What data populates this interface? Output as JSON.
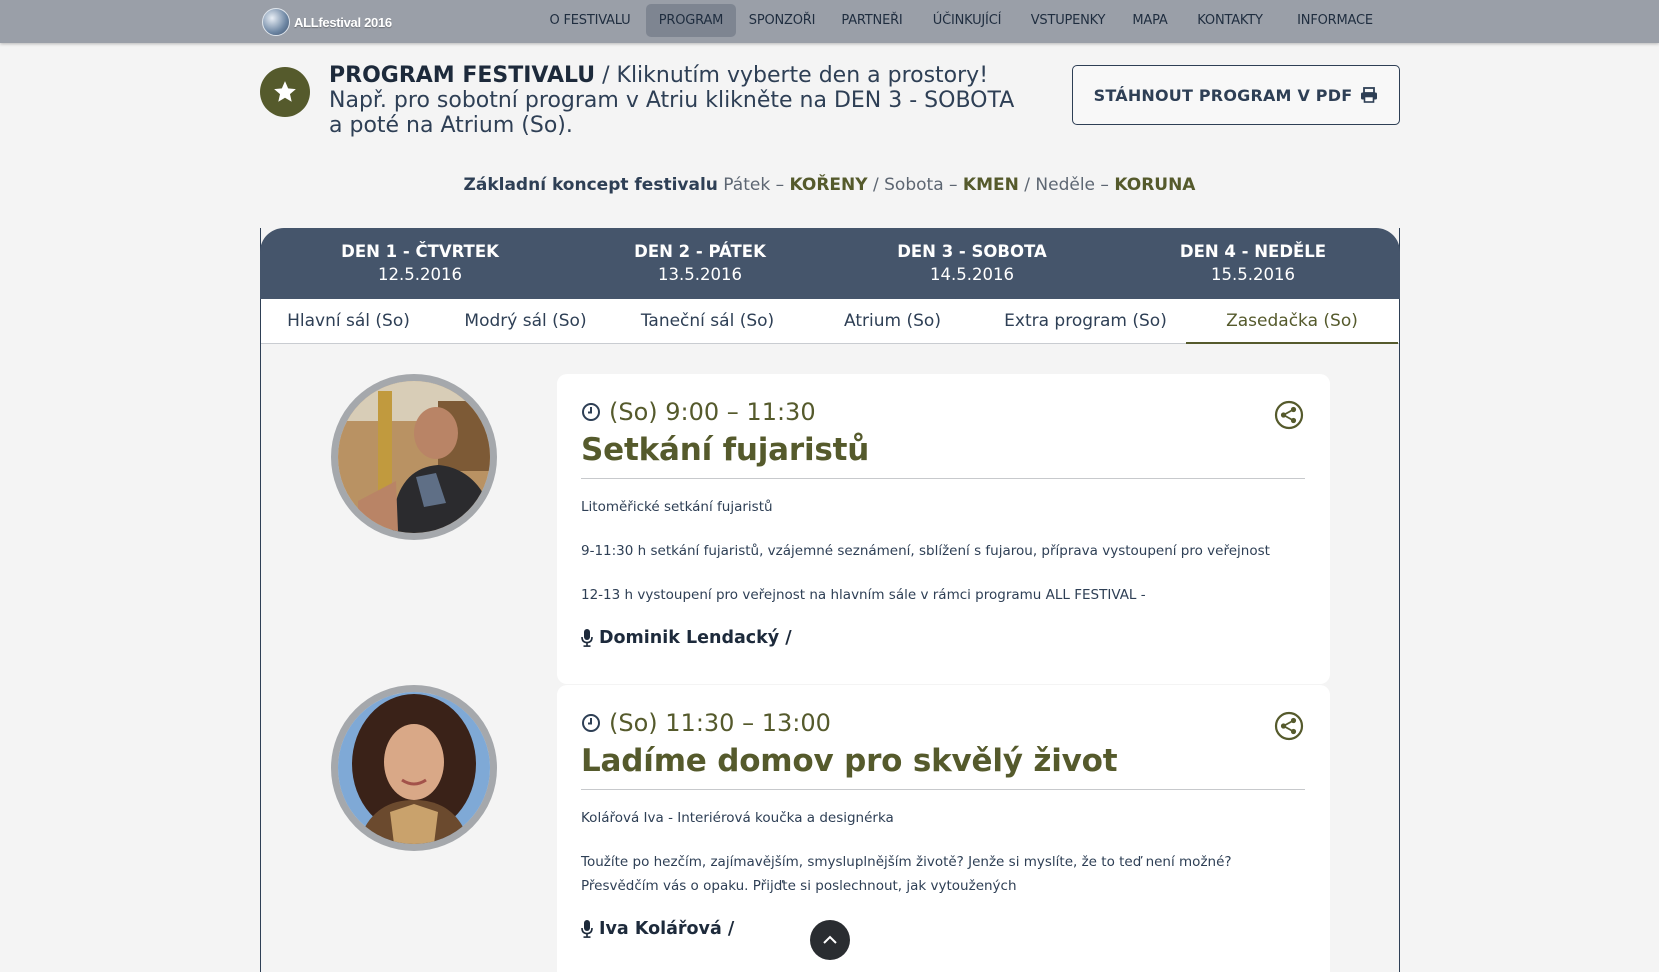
{
  "nav": {
    "logo_text": "ALLfestival 2016",
    "items": [
      {
        "label": "O FESTIVALU"
      },
      {
        "label": "PROGRAM"
      },
      {
        "label": "SPONZOŘI"
      },
      {
        "label": "PARTNEŘI"
      },
      {
        "label": "ÚČINKUJÍCÍ"
      },
      {
        "label": "VSTUPENKY"
      },
      {
        "label": "MAPA"
      },
      {
        "label": "KONTAKTY"
      },
      {
        "label": "INFORMACE"
      }
    ],
    "active": "PROGRAM"
  },
  "header": {
    "title": "PROGRAM FESTIVALU",
    "separator": " / ",
    "subtitle_line1": "Kliknutím vyberte den a prostory!",
    "subtitle_line2": "Např. pro sobotní program v Atriu klikněte na DEN 3 - SOBOTA",
    "subtitle_line3": "a poté na Atrium (So).",
    "pdf_button": "STÁHNOUT PROGRAM V PDF"
  },
  "concept": {
    "lead": "Základní koncept festivalu",
    "day1": "Pátek",
    "root1": "KOŘENY",
    "day2": "Sobota",
    "root2": "KMEN",
    "day3": "Neděle",
    "root3": "KORUNA",
    "dash": " – ",
    "slash": " / "
  },
  "days": [
    {
      "name": "DEN 1 - ČTVRTEK",
      "date": "12.5.2016"
    },
    {
      "name": "DEN 2 - PÁTEK",
      "date": "13.5.2016"
    },
    {
      "name": "DEN 3 - SOBOTA",
      "date": "14.5.2016"
    },
    {
      "name": "DEN 4 - NEDĚLE",
      "date": "15.5.2016"
    }
  ],
  "active_day": "DEN 3 - SOBOTA",
  "rooms": [
    {
      "label": "Hlavní sál (So)"
    },
    {
      "label": "Modrý sál (So)"
    },
    {
      "label": "Taneční sál (So)"
    },
    {
      "label": "Atrium (So)"
    },
    {
      "label": "Extra program (So)"
    },
    {
      "label": "Zasedačka (So)"
    }
  ],
  "active_room": "Zasedačka (So)",
  "events": [
    {
      "time": "(So) 9:00 – 11:30",
      "title": "Setkání fujaristů",
      "paragraphs": [
        "Litoměřické setkání fujaristů",
        "9-11:30 h setkání fujaristů, vzájemné seznámení, sblížení s fujarou, příprava vystoupení pro veřejnost",
        "12-13 h vystoupení pro veřejnost na hlavním sále v rámci programu ALL FESTIVAL -"
      ],
      "speaker": "Dominik Lendacký /"
    },
    {
      "time": "(So) 11:30 – 13:00",
      "title": "Ladíme domov pro skvělý život",
      "paragraphs": [
        "Kolářová Iva - Interiérová koučka a designérka",
        "Toužíte po hezčím, zajímavějším, smysluplnějším životě? Jenže si myslíte, že to teď není možné?",
        "Přesvědčím vás o opaku. Přijďte si poslechnout, jak vytoužených"
      ],
      "speaker": "Iva Kolářová /"
    }
  ],
  "icons": {
    "star": "star-icon",
    "print": "printer-icon",
    "clock": "clock-icon",
    "share": "share-icon",
    "mic": "microphone-icon",
    "up": "chevron-up-icon"
  },
  "colors": {
    "navbar": "#9a9fa8",
    "accent_olive": "#555a2c",
    "navy": "#2e3f55",
    "day_bar": "#45556b"
  }
}
